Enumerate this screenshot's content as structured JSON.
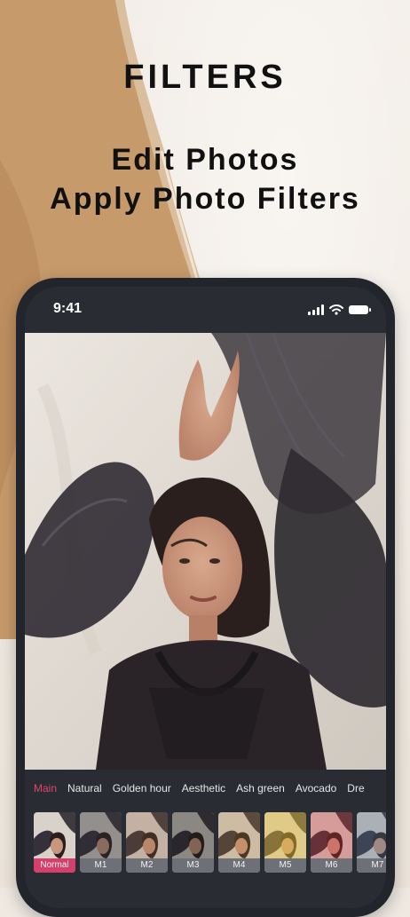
{
  "headline": {
    "title": "FILTERS",
    "subtitle_line1": "Edit Photos",
    "subtitle_line2": "Apply Photo Filters"
  },
  "status_bar": {
    "time": "9:41"
  },
  "filter_categories": [
    {
      "label": "Main",
      "active": true
    },
    {
      "label": "Natural",
      "active": false
    },
    {
      "label": "Golden hour",
      "active": false
    },
    {
      "label": "Aesthetic",
      "active": false
    },
    {
      "label": "Ash green",
      "active": false
    },
    {
      "label": "Avocado",
      "active": false
    },
    {
      "label": "Dre",
      "active": false
    }
  ],
  "filters": [
    {
      "label": "Normal",
      "selected": true,
      "tint": "#00000000"
    },
    {
      "label": "M1",
      "selected": false,
      "tint": "#2b2b3366"
    },
    {
      "label": "M2",
      "selected": false,
      "tint": "#8a5a3a44"
    },
    {
      "label": "M3",
      "selected": false,
      "tint": "#1a1a1a66"
    },
    {
      "label": "M4",
      "selected": false,
      "tint": "#b0803a44"
    },
    {
      "label": "M5",
      "selected": false,
      "tint": "#e8c23a77"
    },
    {
      "label": "M6",
      "selected": false,
      "tint": "#d0303855"
    },
    {
      "label": "M7",
      "selected": false,
      "tint": "#4d6b9055"
    }
  ],
  "colors": {
    "accent": "#e0466f",
    "active_label_bg": "#d63f6b",
    "phone_body": "#23252c"
  }
}
